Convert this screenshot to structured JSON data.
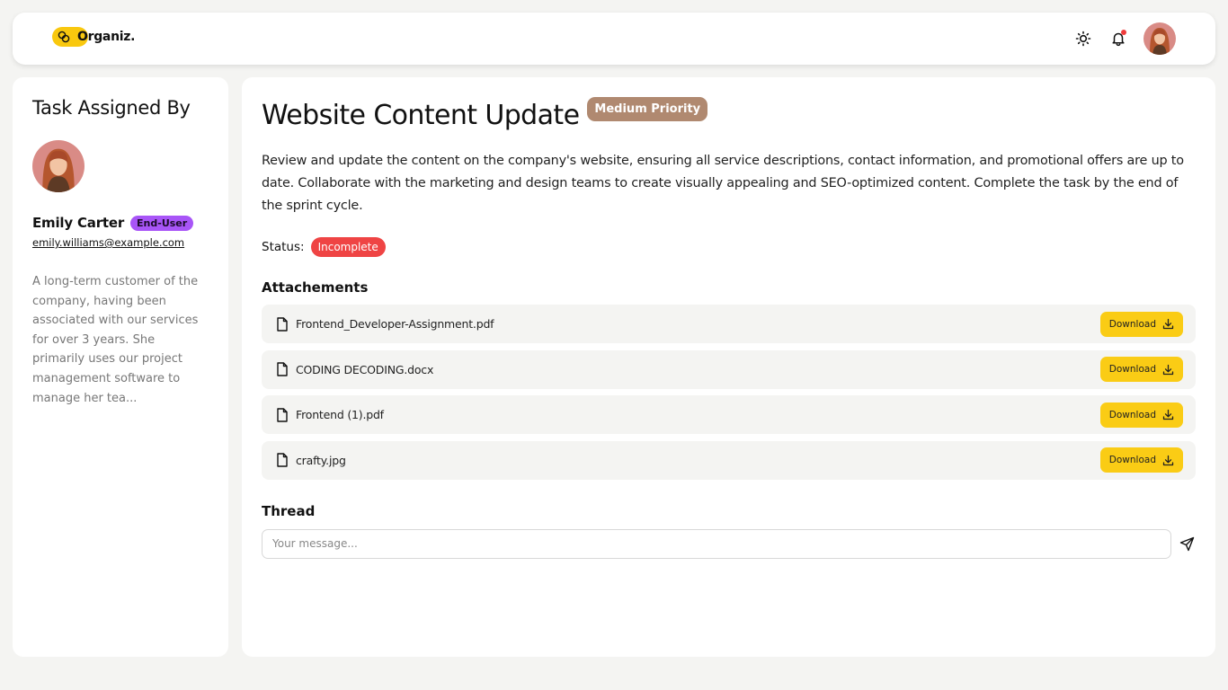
{
  "header": {
    "brand": "Organiz.",
    "icons": [
      "sun-icon",
      "bell-icon",
      "avatar"
    ],
    "notification_dot_color": "#ef3b3b",
    "accent_color": "#f9c80e"
  },
  "sidebar": {
    "title": "Task Assigned By",
    "user": {
      "name": "Emily Carter",
      "role": "End-User",
      "email": "emily.williams@example.com",
      "bio": "A long-term customer of the company, having been associated with our services for over 3 years. She primarily uses our project management software to manage her tea..."
    }
  },
  "task": {
    "title": "Website Content Update",
    "priority": "Medium Priority",
    "description": "Review and update the content on the company's website, ensuring all service descriptions, contact information, and promotional offers are up to date. Collaborate with the marketing and design teams to create visually appealing and SEO-optimized content. Complete the task by the end of the sprint cycle.",
    "status_label": "Status:",
    "status": "Incomplete",
    "colors": {
      "priority": "#b08970",
      "status": "#ef4444",
      "role": "#a855f7"
    }
  },
  "attachments": {
    "title": "Attachements",
    "download_label": "Download",
    "files": [
      {
        "name": "Frontend_Developer-Assignment.pdf"
      },
      {
        "name": "CODING DECODING.docx"
      },
      {
        "name": "Frontend (1).pdf"
      },
      {
        "name": "crafty.jpg"
      }
    ]
  },
  "thread": {
    "title": "Thread",
    "input_placeholder": "Your message...",
    "input_value": ""
  }
}
